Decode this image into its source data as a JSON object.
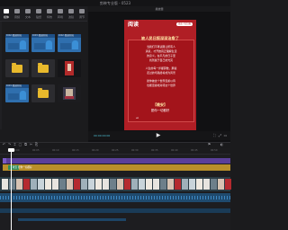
{
  "window": {
    "title": "剪映专业版 - 0523"
  },
  "media_toolbar": {
    "items": [
      {
        "label": "媒体",
        "icon": "media-icon",
        "active": true
      },
      {
        "label": "音频",
        "icon": "audio-icon"
      },
      {
        "label": "文本",
        "icon": "text-icon"
      },
      {
        "label": "贴纸",
        "icon": "sticker-icon"
      },
      {
        "label": "特效",
        "icon": "effects-icon"
      },
      {
        "label": "转场",
        "icon": "transition-icon"
      },
      {
        "label": "滤镜",
        "icon": "filter-icon"
      },
      {
        "label": "调节",
        "icon": "adjust-icon"
      }
    ]
  },
  "media_grid": {
    "cards": [
      {
        "type": "video",
        "caption": "0:02 视频片段"
      },
      {
        "type": "video",
        "caption": "0:03 视频片段"
      },
      {
        "type": "video",
        "caption": "0:02 视频片段"
      },
      {
        "type": "folder",
        "caption": ""
      },
      {
        "type": "folder",
        "caption": ""
      },
      {
        "type": "thumb",
        "caption": ""
      },
      {
        "type": "video",
        "caption": "0:03 视频片段"
      },
      {
        "type": "folder",
        "caption": ""
      },
      {
        "type": "thumb2",
        "caption": ""
      }
    ]
  },
  "player": {
    "title": "播放器",
    "logo": "阅读",
    "badge": "夜读·人民日报",
    "headline": "被人民日报深深治愈了",
    "paragraphs": [
      "当我们不再试图让所有人",
      "满意，才开始真正理解生活",
      "的意义。在平凡的日子里",
      "找到属于自己的光亮",
      "",
      "人生的每一步都算数，那些",
      "走过的弯路终将成为风景",
      "",
      "愿你被这个世界温柔以待",
      "也能温柔地对待这个世界"
    ],
    "headline2": "【晚安】",
    "headline3": "愿你一切都好",
    "quote_mark": "“",
    "time_current": "00:00:00:00",
    "time_total": "",
    "play_glyph": "▶",
    "controls": [
      "⛶",
      "⤢",
      "▭"
    ]
  },
  "timeline": {
    "tools": [
      "↶",
      "↷",
      "⌶",
      "▢",
      "⧉",
      "✂",
      "⎘",
      "⚑",
      "◐"
    ],
    "ruler": [
      "00:00",
      "00:05",
      "00:10",
      "00:15",
      "00:20",
      "00:25",
      "00:30",
      "00:35",
      "00:40",
      "00:45",
      "00:50"
    ],
    "gold_clip_label": "晚安 愿你一切都好",
    "colors": {
      "purple": "#5a3f9a",
      "gold": "#b98f2a",
      "audio": "#1f4a6e"
    }
  }
}
